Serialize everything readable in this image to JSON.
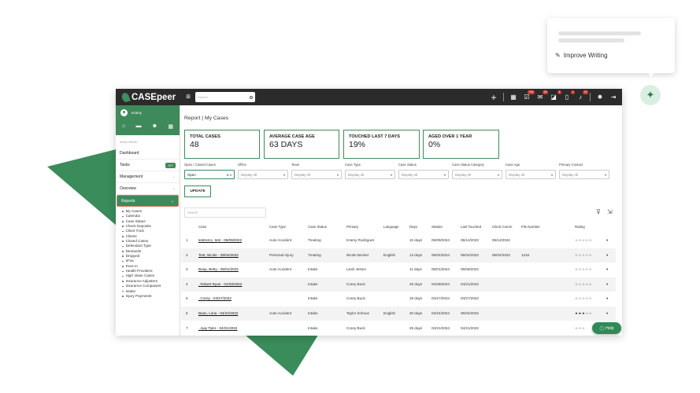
{
  "popup": {
    "improve_label": "Improve Writing",
    "improve_icon": "wand-icon"
  },
  "ai_assistant": {
    "icon": "sparkle-icon"
  },
  "topbar": {
    "brand": "CASEpeer",
    "search_placeholder": "Search",
    "icons": [
      {
        "name": "plus-icon",
        "badge": ""
      },
      {
        "name": "calendar-icon",
        "badge": ""
      },
      {
        "name": "tasks-icon",
        "badge": "741"
      },
      {
        "name": "mail-icon",
        "badge": "23"
      },
      {
        "name": "inbox-icon",
        "badge": "1"
      },
      {
        "name": "phone-icon",
        "badge": "1"
      },
      {
        "name": "bell-icon",
        "badge": "72"
      },
      {
        "name": "gear-icon",
        "badge": ""
      },
      {
        "name": "logout-icon",
        "badge": ""
      }
    ]
  },
  "sidebar": {
    "user_name": "Kramy",
    "main_menu_label": "MAIN MENU",
    "items": [
      {
        "label": "Dashboard",
        "badge": "",
        "chevron": false
      },
      {
        "label": "Tasks",
        "badge": "377",
        "chevron": false
      },
      {
        "label": "Management",
        "badge": "",
        "chevron": true
      },
      {
        "label": "Overview",
        "badge": "",
        "chevron": true
      }
    ],
    "active_item": "Reports",
    "sub_items": [
      "My Cases",
      "Calendar",
      "Case Status",
      "Check Deposits",
      "Client Trust",
      "Clients",
      "Closed Cases",
      "Defendant Type",
      "Demands",
      "Dropped",
      "eFax",
      "Fees In",
      "Health Providers",
      "High Value Cases",
      "Insurance Adjusters",
      "Insurance Companies",
      "Intake",
      "Injury Payments"
    ]
  },
  "main": {
    "title": "Report | My Cases",
    "stats": [
      {
        "label": "TOTAL CASES",
        "value": "48"
      },
      {
        "label": "AVERAGE CASE AGE",
        "value": "63 DAYS"
      },
      {
        "label": "TOUCHED LAST 7 DAYS",
        "value": "19%"
      },
      {
        "label": "AGED OVER 1 YEAR",
        "value": "0%"
      }
    ],
    "filters": [
      {
        "label": "Open / Closed Cases",
        "value": "Open"
      },
      {
        "label": "Office",
        "value": "Display All"
      },
      {
        "label": "Team",
        "value": "Display All"
      },
      {
        "label": "Case Type",
        "value": "Display All"
      },
      {
        "label": "Case Status",
        "value": "Display All"
      },
      {
        "label": "Case Status Category",
        "value": "Display All"
      },
      {
        "label": "Case Age",
        "value": "Display All"
      },
      {
        "label": "Primary Contact",
        "value": "Display All"
      }
    ],
    "update_label": "UPDATE",
    "table_search_placeholder": "Search",
    "columns": [
      "Case",
      "Case Type",
      "Case Status",
      "Primary",
      "Language",
      "Days",
      "Statute",
      "Last Touched",
      "Client Comm",
      "File Number",
      "Rating"
    ],
    "rows": [
      {
        "n": "1",
        "case": "testmzcc, test - 05/09/2022",
        "type": "Auto Accident",
        "status": "Treating",
        "primary": "Kramy Rodriguez",
        "lang": "",
        "days": "10 days",
        "statute": "05/09/2024",
        "touched": "05/12/2022",
        "comm": "05/12/2022",
        "file": "",
        "rating": "☆☆☆☆☆"
      },
      {
        "n": "2",
        "case": "Test, Nicole - 05/04/2022",
        "type": "Personal Injury",
        "status": "Treating",
        "primary": "Nicole Becker",
        "lang": "English",
        "days": "13 days",
        "statute": "05/04/2024",
        "touched": "05/04/2022",
        "comm": "05/04/2022",
        "file": "1234",
        "rating": "☆☆☆☆☆"
      },
      {
        "n": "3",
        "case": "Boop, Betty - 05/01/2022",
        "type": "Auto Accident",
        "status": "Intake",
        "primary": "Leah Jeston",
        "lang": "",
        "days": "11 days",
        "statute": "05/01/2024",
        "touched": "05/06/2022",
        "comm": "",
        "file": "",
        "rating": "☆☆☆☆☆"
      },
      {
        "n": "4",
        "case": ", Robert Ryan - 04/28/2022",
        "type": "",
        "status": "Intake",
        "primary": "Corey Buck",
        "lang": "",
        "days": "26 days",
        "statute": "04/28/2024",
        "touched": "04/21/2022",
        "comm": "",
        "file": "",
        "rating": "☆☆☆☆☆"
      },
      {
        "n": "5",
        "case": ", Corey - 04/27/2022",
        "type": "",
        "status": "Intake",
        "primary": "Corey Buck",
        "lang": "",
        "days": "19 days",
        "statute": "04/27/2024",
        "touched": "04/27/2022",
        "comm": "",
        "file": "",
        "rating": "☆☆☆☆☆"
      },
      {
        "n": "6",
        "case": "Bean, Lima - 04/24/2022",
        "type": "Auto Accident",
        "status": "Intake",
        "primary": "Taylor Schous",
        "lang": "English",
        "days": "20 days",
        "statute": "04/24/2024",
        "touched": "05/04/2022",
        "comm": "",
        "file": "",
        "rating": "★★★☆☆"
      },
      {
        "n": "7",
        "case": ", Ajay Tyler - 04/21/2022",
        "type": "",
        "status": "Intake",
        "primary": "Corey Buck",
        "lang": "",
        "days": "25 days",
        "statute": "04/21/2024",
        "touched": "04/21/2022",
        "comm": "",
        "file": "",
        "rating": "☆☆☆"
      }
    ],
    "help_label": "Help"
  },
  "colors": {
    "brand_green": "#3f8a5a",
    "topbar": "#2b2b2b",
    "deco_green": "#3a8c5a",
    "badge_red": "#e0342e"
  }
}
